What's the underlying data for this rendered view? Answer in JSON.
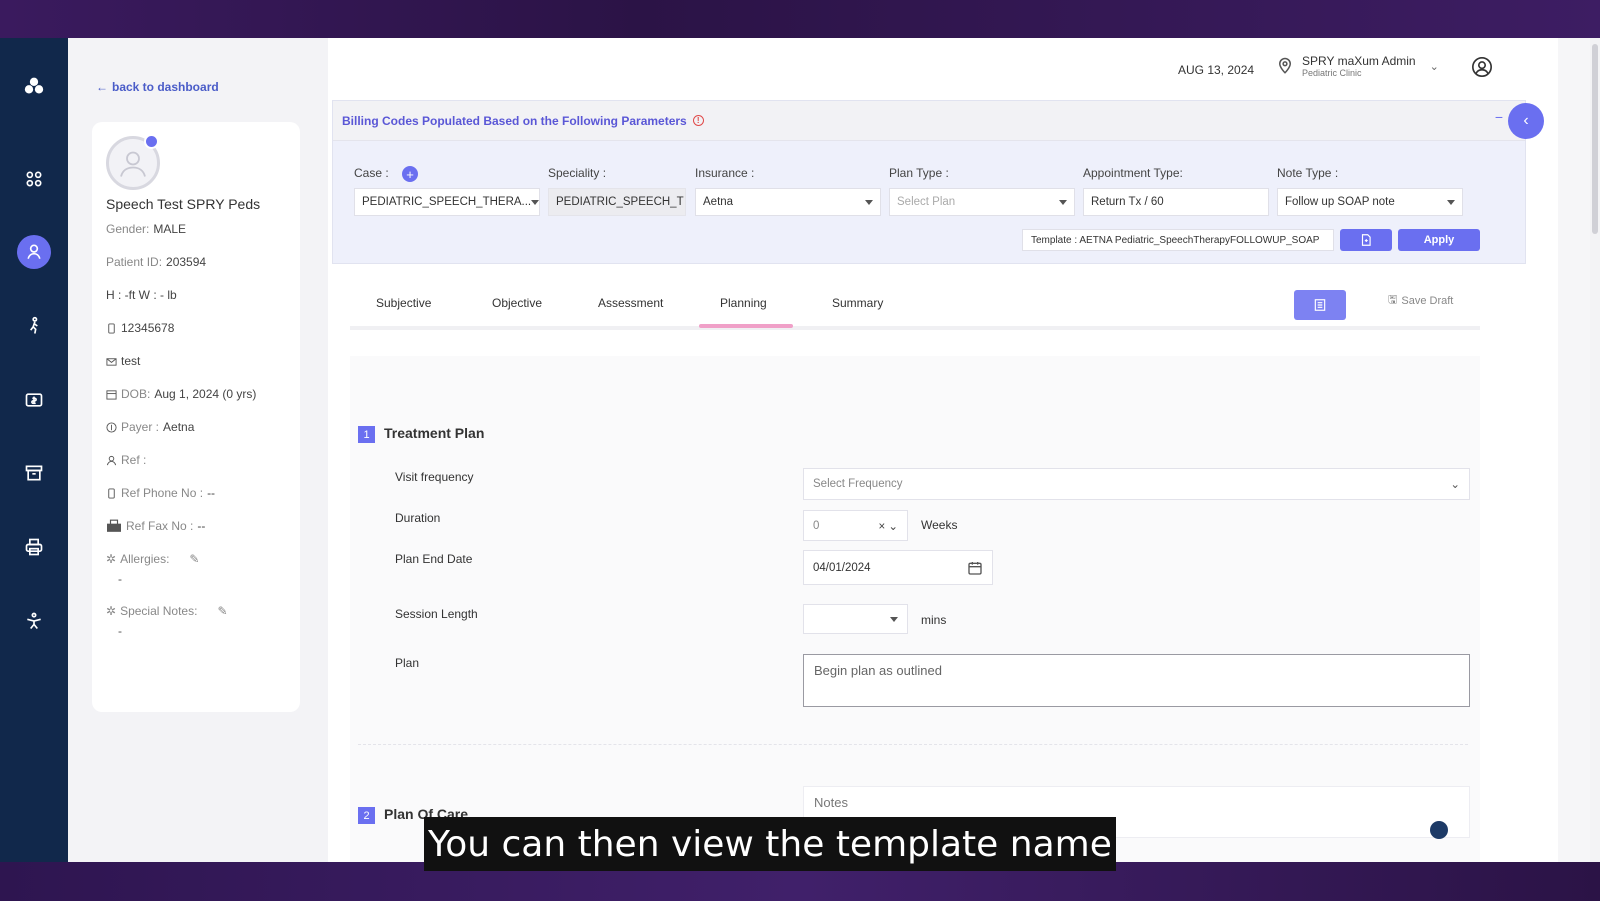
{
  "nav": {
    "items": [
      "logo-icon",
      "grid-icon",
      "patient-icon",
      "walk-icon",
      "billing-icon",
      "archive-icon",
      "print-icon",
      "yoga-icon"
    ]
  },
  "patient": {
    "back_label": "back to dashboard",
    "name": "Speech Test SPRY Peds",
    "gender_label": "Gender:",
    "gender": "MALE",
    "id_label": "Patient ID:",
    "id": "203594",
    "hw": "H : -ft W : - lb",
    "phone": "12345678",
    "email": "test",
    "dob_label": "DOB:",
    "dob": "Aug 1, 2024 (0 yrs)",
    "payer_label": "Payer :",
    "payer": "Aetna",
    "ref_label": "Ref :",
    "ref_phone_label": "Ref Phone No :",
    "ref_phone": "--",
    "ref_fax_label": "Ref Fax No :",
    "ref_fax": "--",
    "allergies_label": "Allergies:",
    "allergies": "-",
    "special_notes_label": "Special Notes:",
    "special_notes": "-"
  },
  "header": {
    "date": "AUG 13, 2024",
    "user_name": "SPRY maXum Admin",
    "clinic": "Pediatric Clinic"
  },
  "billing": {
    "title": "Billing Codes Populated Based on the Following Parameters",
    "case_label": "Case :",
    "case_value": "PEDIATRIC_SPEECH_THERA...",
    "speciality_label": "Speciality :",
    "speciality_value": "PEDIATRIC_SPEECH_T",
    "insurance_label": "Insurance :",
    "insurance_value": "Aetna",
    "plan_type_label": "Plan Type :",
    "plan_type_placeholder": "Select Plan",
    "appointment_label": "Appointment Type:",
    "appointment_value": "Return Tx / 60",
    "note_type_label": "Note Type :",
    "note_type_value": "Follow up SOAP note",
    "template": "Template : AETNA Pediatric_SpeechTherapyFOLLOWUP_SOAP",
    "apply_label": "Apply"
  },
  "tabs": {
    "items": [
      "Subjective",
      "Objective",
      "Assessment",
      "Planning",
      "Summary"
    ],
    "active": "Planning",
    "save_draft": "Save Draft"
  },
  "treatment_plan": {
    "number": "1",
    "title": "Treatment Plan",
    "visit_frequency_label": "Visit frequency",
    "visit_frequency_placeholder": "Select Frequency",
    "duration_label": "Duration",
    "duration_value": "0",
    "duration_unit": "Weeks",
    "end_date_label": "Plan End Date",
    "end_date_value": "04/01/2024",
    "session_length_label": "Session Length",
    "session_unit": "mins",
    "plan_label": "Plan",
    "plan_value": "Begin plan as outlined"
  },
  "plan_of_care": {
    "number": "2",
    "title": "Plan Of Care",
    "notes_placeholder": "Notes"
  },
  "subtitle": "You can then view the template name",
  "colors": {
    "accent": "#6a6ff0",
    "nav_bg": "#11284b",
    "tab_active": "#f0a0c8"
  }
}
